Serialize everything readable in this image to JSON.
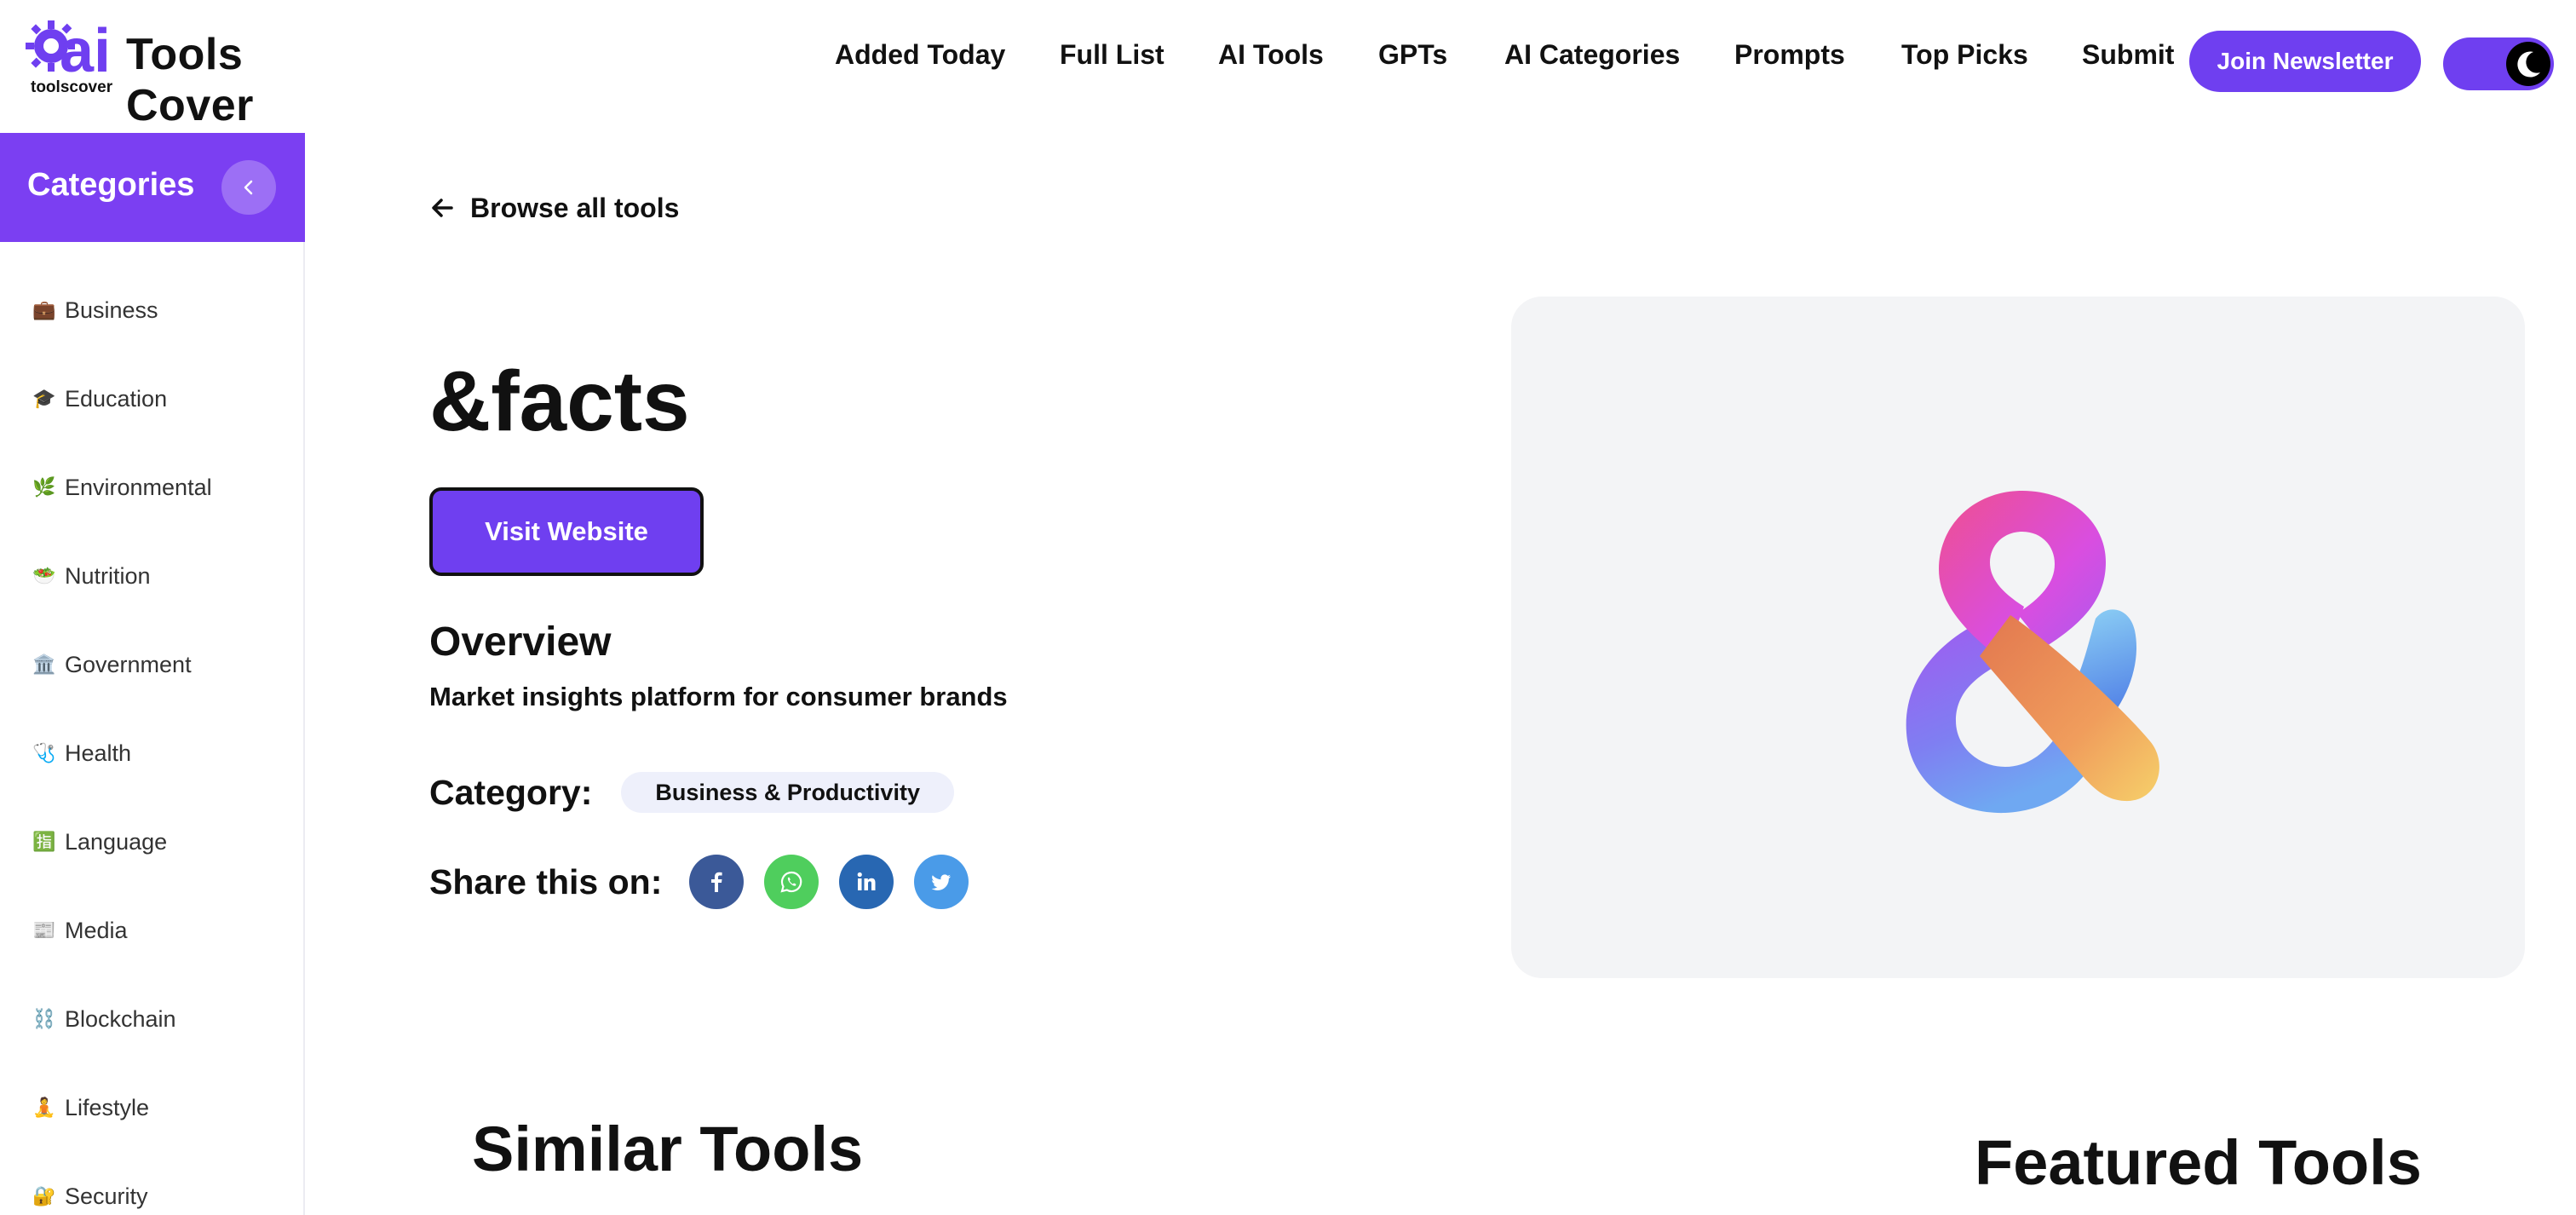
{
  "header": {
    "logo_sub": "toolscover",
    "logo_title": "Tools Cover",
    "logo_mark_text": "ai",
    "nav": [
      {
        "label": "Added Today"
      },
      {
        "label": "Full List"
      },
      {
        "label": "AI Tools"
      },
      {
        "label": "GPTs"
      },
      {
        "label": "AI Categories"
      },
      {
        "label": "Prompts"
      },
      {
        "label": "Top Picks"
      },
      {
        "label": "Submit"
      }
    ],
    "join_label": "Join Newsletter",
    "theme_icon": "moon-icon"
  },
  "sidebar": {
    "title": "Categories",
    "collapse_icon": "chevron-left-icon",
    "items": [
      {
        "emoji": "💼",
        "label": "Business"
      },
      {
        "emoji": "🎓",
        "label": "Education"
      },
      {
        "emoji": "🌿",
        "label": "Environmental"
      },
      {
        "emoji": "🥗",
        "label": "Nutrition"
      },
      {
        "emoji": "🏛️",
        "label": "Government"
      },
      {
        "emoji": "🩺",
        "label": "Health"
      },
      {
        "emoji": "🈯",
        "label": "Language"
      },
      {
        "emoji": "📰",
        "label": "Media"
      },
      {
        "emoji": "⛓️",
        "label": "Blockchain"
      },
      {
        "emoji": "🧘",
        "label": "Lifestyle"
      },
      {
        "emoji": "🔐",
        "label": "Security"
      }
    ]
  },
  "main": {
    "back_label": "Browse all tools",
    "tool_name": "&facts",
    "visit_label": "Visit Website",
    "overview_heading": "Overview",
    "overview_text": "Market insights platform for consumer brands",
    "category_label": "Category:",
    "category_value": "Business & Productivity",
    "share_label": "Share this on:",
    "share": [
      {
        "icon": "facebook-icon",
        "color": "#3b5998"
      },
      {
        "icon": "whatsapp-icon",
        "color": "#4fce5d"
      },
      {
        "icon": "linkedin-icon",
        "color": "#2867b2"
      },
      {
        "icon": "twitter-icon",
        "color": "#4a9be8"
      }
    ],
    "similar_heading": "Similar Tools",
    "featured_heading": "Featured Tools"
  },
  "colors": {
    "brand": "#6f3ff0",
    "sidebar_head": "#7b3ff2",
    "preview_bg": "#f3f4f6"
  }
}
